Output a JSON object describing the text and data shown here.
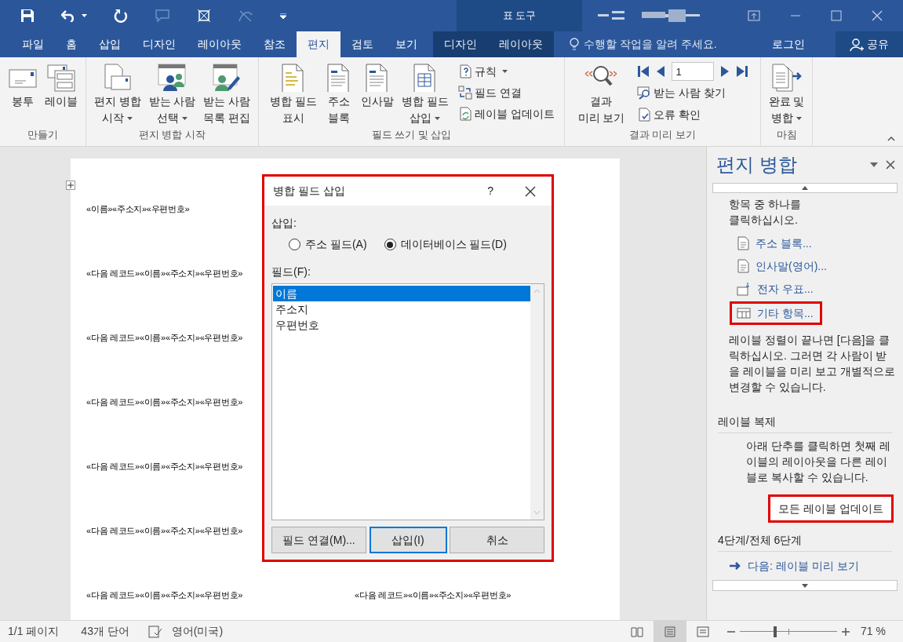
{
  "title_bar": {
    "contextual_label": "표 도구"
  },
  "tabs": [
    {
      "label": "파일",
      "selected": false,
      "contextual": false
    },
    {
      "label": "홈",
      "selected": false,
      "contextual": false
    },
    {
      "label": "삽입",
      "selected": false,
      "contextual": false
    },
    {
      "label": "디자인",
      "selected": false,
      "contextual": false
    },
    {
      "label": "레이아웃",
      "selected": false,
      "contextual": false
    },
    {
      "label": "참조",
      "selected": false,
      "contextual": false
    },
    {
      "label": "편지",
      "selected": true,
      "contextual": false
    },
    {
      "label": "검토",
      "selected": false,
      "contextual": false
    },
    {
      "label": "보기",
      "selected": false,
      "contextual": false
    },
    {
      "label": "디자인",
      "selected": false,
      "contextual": true
    },
    {
      "label": "레이아웃",
      "selected": false,
      "contextual": true
    }
  ],
  "tell_me": {
    "placeholder": "수행할 작업을 알려 주세요."
  },
  "login": "로그인",
  "share": "공유",
  "ribbon": {
    "groups": [
      {
        "label": "만들기",
        "items": [
          {
            "kind": "large",
            "lines": [
              "봉투"
            ],
            "dropdown": false
          },
          {
            "kind": "large",
            "lines": [
              "레이블"
            ],
            "dropdown": false
          }
        ]
      },
      {
        "label": "편지 병합 시작",
        "items": [
          {
            "kind": "large",
            "lines": [
              "편지 병합",
              "시작"
            ],
            "dropdown": true
          },
          {
            "kind": "large",
            "lines": [
              "받는 사람",
              "선택"
            ],
            "dropdown": true
          },
          {
            "kind": "large",
            "lines": [
              "받는 사람",
              "목록 편집"
            ],
            "dropdown": false
          }
        ]
      },
      {
        "label": "필드 쓰기 및 삽입",
        "items": [
          {
            "kind": "large",
            "lines": [
              "병합 필드",
              "표시"
            ],
            "dropdown": false
          },
          {
            "kind": "large",
            "lines": [
              "주소",
              "블록"
            ],
            "dropdown": false
          },
          {
            "kind": "large",
            "lines": [
              "인사말"
            ],
            "dropdown": false
          },
          {
            "kind": "large",
            "lines": [
              "병합 필드",
              "삽입"
            ],
            "dropdown": true
          },
          {
            "kind": "small_column",
            "items": [
              {
                "label": "규칙",
                "dropdown": true
              },
              {
                "label": "필드 연결",
                "dropdown": false
              },
              {
                "label": "레이블 업데이트",
                "dropdown": false
              }
            ]
          }
        ]
      },
      {
        "label": "결과 미리 보기",
        "items": [
          {
            "kind": "large",
            "lines": [
              "결과",
              "미리 보기"
            ],
            "dropdown": false
          },
          {
            "kind": "nav",
            "value": "1",
            "items": [
              {
                "label": "받는 사람 찾기",
                "dropdown": false
              },
              {
                "label": "오류 확인",
                "dropdown": false
              }
            ]
          }
        ]
      },
      {
        "label": "마침",
        "items": [
          {
            "kind": "large",
            "lines": [
              "완료 및",
              "병합"
            ],
            "dropdown": true
          }
        ]
      }
    ]
  },
  "document": {
    "rows": [
      {
        "cells": [
          "«이름»«주소지»«우편번호»"
        ]
      },
      {
        "cells": [
          "«다음 레코드»«이름»«주소지»«우편번호»"
        ]
      },
      {
        "cells": [
          "«다음 레코드»«이름»«주소지»«우편번호»"
        ]
      },
      {
        "cells": [
          "«다음 레코드»«이름»«주소지»«우편번호»"
        ]
      },
      {
        "cells": [
          "«다음 레코드»«이름»«주소지»«우편번호»"
        ]
      },
      {
        "cells": [
          "«다음 레코드»«이름»«주소지»«우편번호»"
        ]
      },
      {
        "cells": [
          "«다음 레코드»«이름»«주소지»«우편번호»",
          "«다음 레코드»«이름»«주소지»«우편번호»"
        ]
      }
    ]
  },
  "dialog": {
    "title": "병합 필드 삽입",
    "help": "?",
    "insert_label": "삽입:",
    "radios": [
      {
        "label": "주소 필드(A)",
        "selected": false
      },
      {
        "label": "데이터베이스 필드(D)",
        "selected": true
      }
    ],
    "fields_label": "필드(F):",
    "fields": [
      {
        "label": "이름",
        "selected": true
      },
      {
        "label": "주소지",
        "selected": false
      },
      {
        "label": "우편번호",
        "selected": false
      }
    ],
    "buttons": [
      {
        "label": "필드 연결(M)...",
        "default": false
      },
      {
        "label": "삽입(I)",
        "default": true
      },
      {
        "label": "취소",
        "default": false
      }
    ]
  },
  "task_pane": {
    "title": "편지 병합",
    "intro": [
      "항목 중 하나를",
      "클릭하십시오."
    ],
    "links": [
      {
        "label": "주소 블록...",
        "highlighted": false
      },
      {
        "label": "인사말(영어)...",
        "highlighted": false
      },
      {
        "label": "전자 우표...",
        "highlighted": false
      },
      {
        "label": "기타 항목...",
        "highlighted": true
      }
    ],
    "note": "레이블 정렬이 끝나면 [다음]을 클릭하십시오. 그러면 각 사람이 받을 레이블을 미리 보고 개별적으로 변경할 수 있습니다.",
    "section": "레이블 복제",
    "section_note": "아래 단추를 클릭하면 첫째 레이블의 레이아웃을 다른 레이블로 복사할 수 있습니다.",
    "update_button": {
      "label": "모든 레이블 업데이트",
      "highlighted": true
    },
    "step": "4단계/전체 6단계",
    "next_link": "다음: 레이블 미리 보기"
  },
  "status_bar": {
    "page": "1/1 페이지",
    "words": "43개 단어",
    "language": "영어(미국)",
    "views": [
      {
        "selected": false
      },
      {
        "selected": true
      },
      {
        "selected": false
      }
    ],
    "zoom": {
      "level": 0.36,
      "reading": "71 %"
    }
  }
}
